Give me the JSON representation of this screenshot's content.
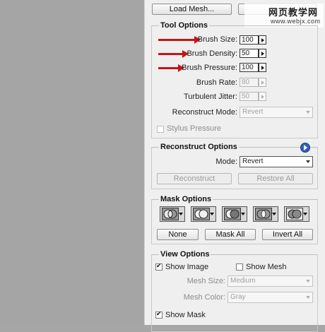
{
  "watermark": {
    "line1": "网页教学网",
    "line2": "www.webjx.com"
  },
  "top": {
    "load_mesh": "Load Mesh..."
  },
  "tool_options": {
    "title": "Tool Options",
    "brush_size": {
      "label": "Brush Size:",
      "value": "100"
    },
    "brush_density": {
      "label": "Brush Density:",
      "value": "50"
    },
    "brush_pressure": {
      "label": "Brush Pressure:",
      "value": "100"
    },
    "brush_rate": {
      "label": "Brush Rate:",
      "value": "80"
    },
    "turbulent_jitter": {
      "label": "Turbulent Jitter:",
      "value": "50"
    },
    "reconstruct_mode": {
      "label": "Reconstruct Mode:",
      "value": "Revert"
    },
    "stylus_pressure": "Stylus Pressure"
  },
  "reconstruct_options": {
    "title": "Reconstruct Options",
    "mode_label": "Mode:",
    "mode_value": "Revert",
    "reconstruct": "Reconstruct",
    "restore_all": "Restore All"
  },
  "mask_options": {
    "title": "Mask Options",
    "none": "None",
    "mask_all": "Mask All",
    "invert_all": "Invert All"
  },
  "view_options": {
    "title": "View Options",
    "show_image": "Show Image",
    "show_mesh": "Show Mesh",
    "mesh_size_label": "Mesh Size:",
    "mesh_size_value": "Medium",
    "mesh_color_label": "Mesh Color:",
    "mesh_color_value": "Gray",
    "show_mask": "Show Mask"
  },
  "colors": {
    "accent_arrow": "#c41515",
    "info_icon": "#2f63b9"
  }
}
